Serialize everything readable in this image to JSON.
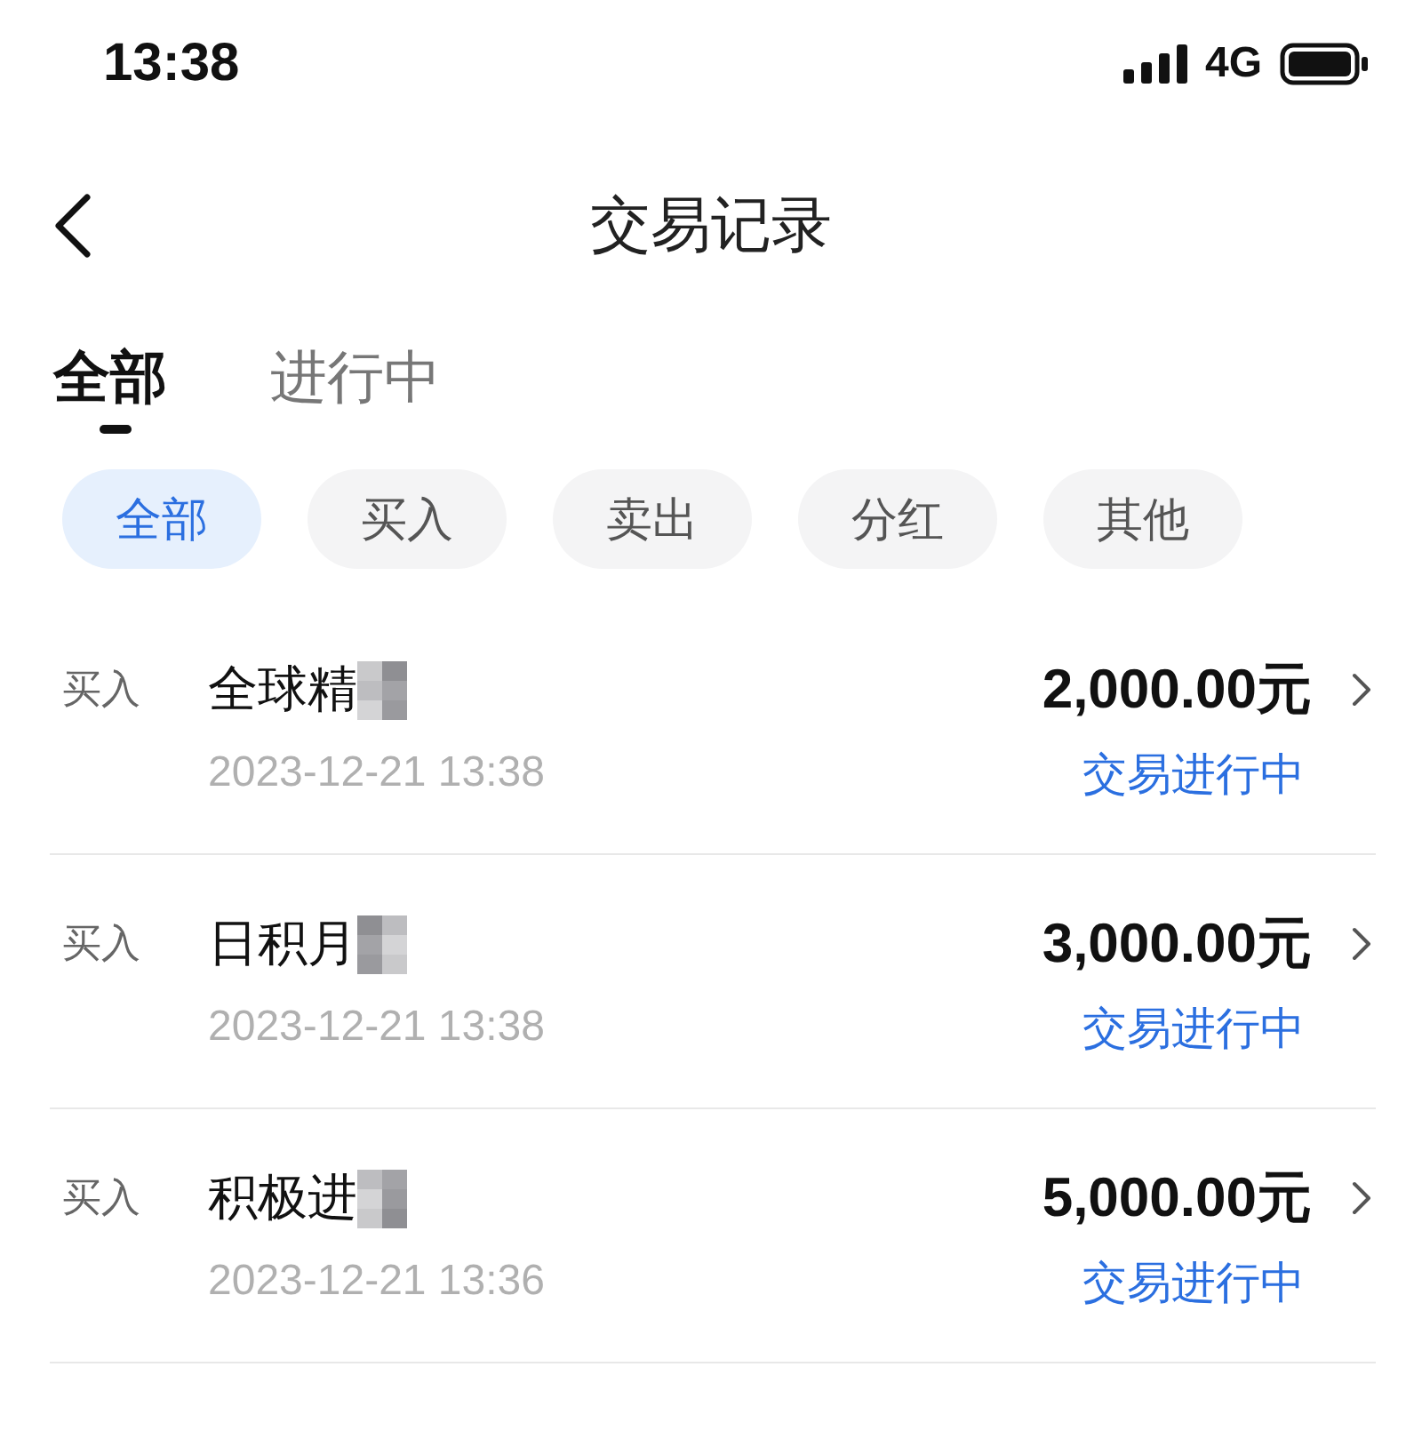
{
  "status_bar": {
    "time": "13:38",
    "network": "4G"
  },
  "header": {
    "title": "交易记录"
  },
  "tabs": [
    {
      "label": "全部",
      "selected": true
    },
    {
      "label": "进行中",
      "selected": false
    }
  ],
  "filters": [
    {
      "label": "全部",
      "selected": true
    },
    {
      "label": "买入",
      "selected": false
    },
    {
      "label": "卖出",
      "selected": false
    },
    {
      "label": "分红",
      "selected": false
    },
    {
      "label": "其他",
      "selected": false
    }
  ],
  "records": [
    {
      "type": "买入",
      "name": "全球精",
      "redacted": true,
      "amount": "2,000.00元",
      "time": "2023-12-21 13:38",
      "status": "交易进行中"
    },
    {
      "type": "买入",
      "name": "日积月",
      "redacted": true,
      "amount": "3,000.00元",
      "time": "2023-12-21 13:38",
      "status": "交易进行中"
    },
    {
      "type": "买入",
      "name": "积极进",
      "redacted": true,
      "amount": "5,000.00元",
      "time": "2023-12-21 13:36",
      "status": "交易进行中"
    }
  ]
}
